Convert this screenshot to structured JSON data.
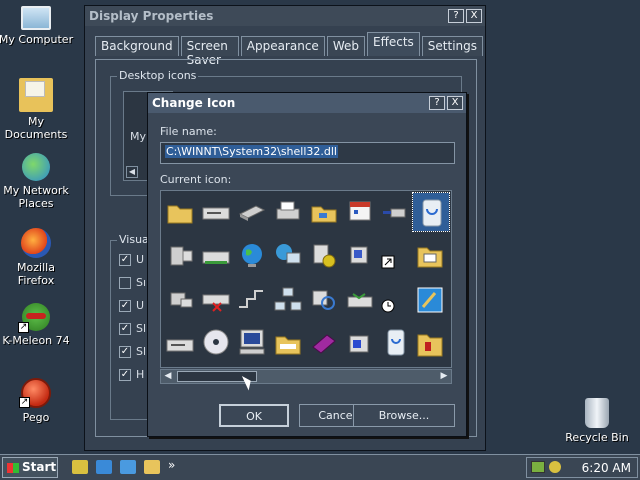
{
  "desktop": {
    "icons": [
      {
        "label": "My Computer"
      },
      {
        "label": "My Documents"
      },
      {
        "label": "My Network Places"
      },
      {
        "label": "Mozilla Firefox"
      },
      {
        "label": "K-Meleon 74"
      },
      {
        "label": "Pego"
      },
      {
        "label": "Recycle Bin"
      }
    ]
  },
  "display_properties": {
    "title": "Display Properties",
    "help_btn": "?",
    "close_btn": "X",
    "tabs": [
      "Background",
      "Screen Saver",
      "Appearance",
      "Web",
      "Effects",
      "Settings"
    ],
    "active_tab": "Effects",
    "desktop_icons_group": "Desktop icons",
    "preview_label": "My",
    "visual_group": "Visual",
    "visual_items": [
      "U",
      "Sı",
      "U",
      "Sl",
      "Sl",
      "H"
    ],
    "visual_checked": [
      true,
      false,
      true,
      true,
      true,
      true
    ]
  },
  "change_icon": {
    "title": "Change Icon",
    "help_btn": "?",
    "close_btn": "X",
    "file_name_label": "File name:",
    "file_name_value": "C:\\WINNT\\System32\\shell32.dll",
    "current_icon_label": "Current icon:",
    "ok_label": "OK",
    "cancel_label": "Cancel",
    "browse_label": "Browse...",
    "scroll_left": "◀",
    "scroll_right": "▶"
  },
  "taskbar": {
    "start_label": "Start",
    "quicklaunch_more": "»",
    "clock": "6:20 AM"
  },
  "colors": {
    "desktop_bg": "#2a3848",
    "selection": "#2f5e98",
    "window_bg": "#354150"
  }
}
